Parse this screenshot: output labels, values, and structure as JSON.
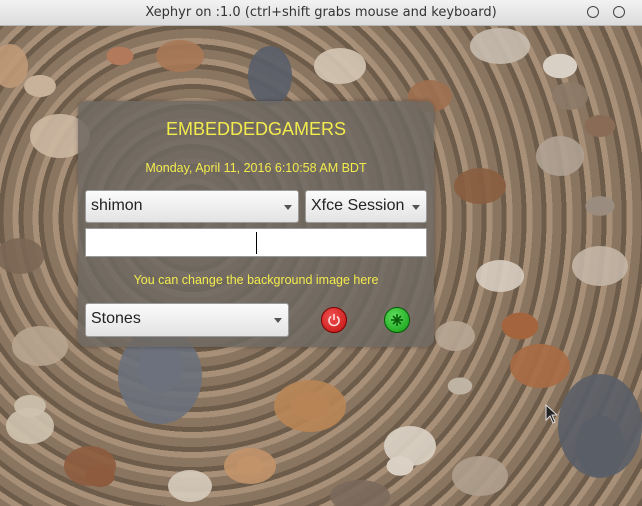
{
  "window": {
    "title": "Xephyr on :1.0 (ctrl+shift grabs mouse and keyboard)"
  },
  "greeter": {
    "hostname": "EMBEDDEDGAMERS",
    "datetime": "Monday, April 11, 2016 6:10:58 AM BDT",
    "user": "shimon",
    "session": "Xfce Session",
    "password_value": "",
    "background_hint": "You can change the background image here",
    "background": "Stones",
    "power_icon": "power-icon",
    "login_icon": "login-icon"
  },
  "colors": {
    "accent_text": "#f3ec4d",
    "power_button": "#d42020",
    "login_button": "#22b222"
  }
}
